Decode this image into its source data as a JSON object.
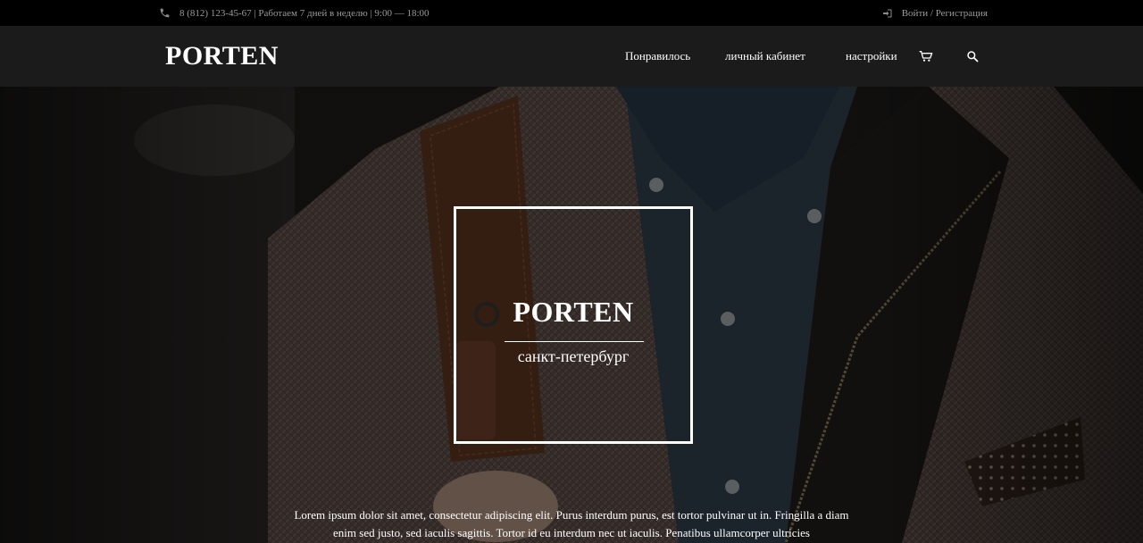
{
  "topbar": {
    "phone_info": "8 (812) 123-45-67 | Работаем 7 дней в неделю | 9:00 — 18:00",
    "auth_label": "Войти / Регистрация",
    "phone_icon": "phone-icon",
    "login_icon": "login-icon"
  },
  "header": {
    "logo": "PORTEN",
    "nav": {
      "liked": "Понравилось",
      "account": "личный кабинет",
      "settings": "настройки"
    },
    "cart_icon": "cart-icon",
    "search_icon": "search-icon"
  },
  "hero": {
    "title": "PORTEN",
    "subtitle": "санкт-петербург",
    "description": "Lorem ipsum dolor sit amet, consectetur adipiscing elit. Purus interdum purus, est tortor pulvinar ut in. Fringilla a diam enim sed justo, sed iaculis sagittis. Tortor id eu interdum nec ut iaculis. Penatibus ullamcorper ultricies",
    "image_alt_icon": "hero-photo"
  },
  "colors": {
    "topbar_bg": "#000000",
    "navbar_bg": "#1b1b1b",
    "text": "#ffffff",
    "muted_text": "#9a9a9a"
  }
}
